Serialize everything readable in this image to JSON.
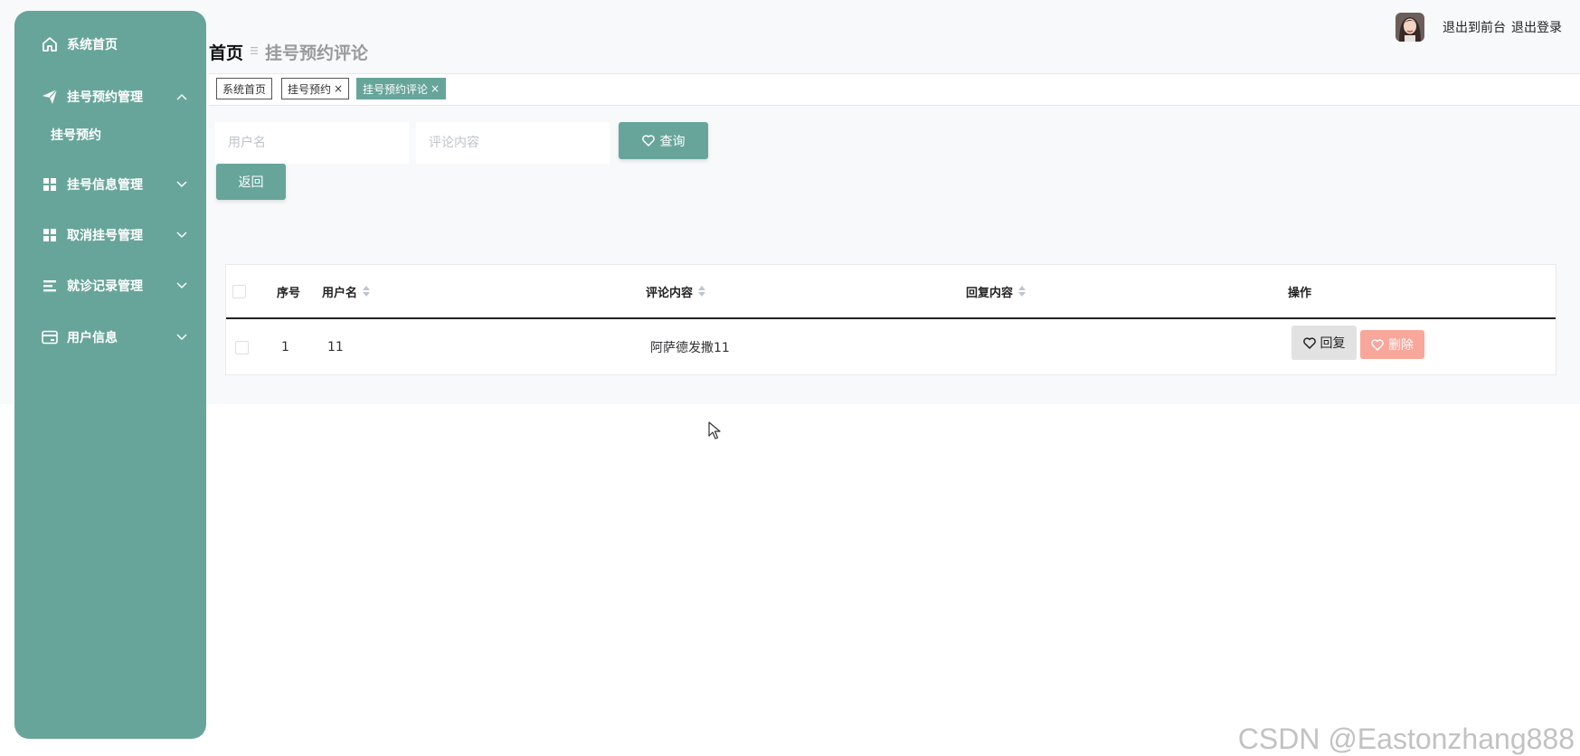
{
  "sidebar": {
    "items": [
      {
        "label": "系统首页",
        "icon": "home-icon"
      },
      {
        "label": "挂号预约管理",
        "icon": "send-icon",
        "expanded": true,
        "children": [
          "挂号预约"
        ]
      },
      {
        "label": "挂号信息管理",
        "icon": "grid-icon"
      },
      {
        "label": "取消挂号管理",
        "icon": "grid-icon"
      },
      {
        "label": "就诊记录管理",
        "icon": "list-icon"
      },
      {
        "label": "用户信息",
        "icon": "card-icon"
      }
    ]
  },
  "header": {
    "home": "首页",
    "current": "挂号预约评论",
    "links": [
      "退出到前台",
      "退出登录"
    ]
  },
  "tags": [
    {
      "label": "系统首页",
      "closable": false,
      "active": false
    },
    {
      "label": "挂号预约",
      "closable": true,
      "active": false
    },
    {
      "label": "挂号预约评论",
      "closable": true,
      "active": true
    }
  ],
  "search": {
    "username_placeholder": "用户名",
    "content_placeholder": "评论内容",
    "query_label": "查询",
    "back_label": "返回"
  },
  "table": {
    "columns": [
      "序号",
      "用户名",
      "评论内容",
      "回复内容",
      "操作"
    ],
    "rows": [
      {
        "index": "1",
        "username": "11",
        "content": "阿萨德发撒11",
        "reply": ""
      }
    ],
    "reply_label": "回复",
    "delete_label": "删除"
  },
  "colors": {
    "primary": "#67a59a",
    "danger": "#f9a79b",
    "reply_bg": "#e2e2e2"
  },
  "watermark": "CSDN @Eastonzhang888"
}
